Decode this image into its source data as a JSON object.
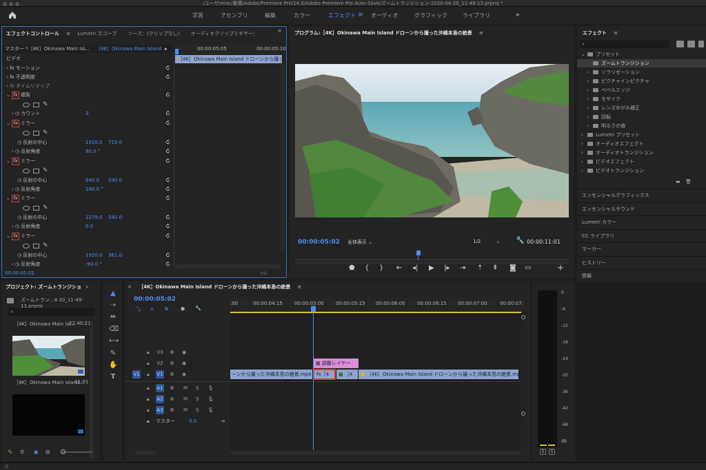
{
  "title": "/ユーザ/mac/書類/Adobe/Premiere Pro/14.0/Adobe Premiere Pro Auto-Save/ズームトランジション-2020-04-20_11-49-13.prproj *",
  "workspaces": [
    "学習",
    "アセンブリ",
    "編集",
    "カラー",
    "エフェクト",
    "オーディオ",
    "グラフィック",
    "ライブラリ"
  ],
  "effect_controls": {
    "tabs": [
      "エフェクトコントロール",
      "Lumetri スコープ",
      "ソース：(クリップなし)",
      "オーディオクリップミキサー："
    ],
    "master": "マスター *［4K］Okinawa Main Isl...",
    "clip": "［4K］Okinawa Main Island ...",
    "ruler": [
      "00:00:05:05",
      "00:00:05:10"
    ],
    "clipbar": "［4K］Okinawa Main Island ドローンから撮った沖縄本島の絶景",
    "section": "ビデオ",
    "motion": "モーション",
    "opacity": "不透明度",
    "timeremap": "タイムリマップ",
    "replicate": "複製",
    "count_label": "カウント",
    "count_value": "3",
    "mirror": "ミラー",
    "center_label": "反射の中心",
    "angle_label": "反射角度",
    "mirrors": [
      {
        "cx": "1920.0",
        "cy": "719.0",
        "angle": "90.0 °"
      },
      {
        "cx": "640.0",
        "cy": "540.0",
        "angle": "180.0 °"
      },
      {
        "cx": "1279.0",
        "cy": "540.0",
        "angle": "0.0"
      },
      {
        "cx": "1920.0",
        "cy": "361.0",
        "angle": "-90.0 °"
      }
    ],
    "timecode": "00:00:05:02"
  },
  "program": {
    "title": "プログラム:［4K］Okinawa Main Island ドローンから撮った沖縄本島の絶景",
    "timecode": "00:00:05:02",
    "zoom": "全体表示",
    "resolution": "1/2",
    "duration": "00:00:11:01"
  },
  "effects": {
    "title": "エフェクト",
    "tree": [
      {
        "label": "プリセット",
        "level": 0,
        "open": true
      },
      {
        "label": "ズームトランジション",
        "level": 1,
        "selected": true
      },
      {
        "label": "ソラリゼーション",
        "level": 1
      },
      {
        "label": "ピクチャインピクチャ",
        "level": 1
      },
      {
        "label": "ベベルエッジ",
        "level": 1
      },
      {
        "label": "モザイク",
        "level": 1
      },
      {
        "label": "レンズゆがみ補正",
        "level": 1
      },
      {
        "label": "回転",
        "level": 1
      },
      {
        "label": "明るさの値",
        "level": 1
      },
      {
        "label": "Lumetri プリセット",
        "level": 0
      },
      {
        "label": "オーディオエフェクト",
        "level": 0
      },
      {
        "label": "オーディオトランジション",
        "level": 0
      },
      {
        "label": "ビデオエフェクト",
        "level": 0
      },
      {
        "label": "ビデオトランジション",
        "level": 0
      }
    ],
    "panels": [
      "エッセンシャルグラフィックス",
      "エッセンシャルサウンド",
      "Lumetri カラー",
      "CC ライブラリ",
      "マーカー",
      "ヒストリー",
      "情報"
    ]
  },
  "project": {
    "title": "プロジェクト: ズームトランジショ",
    "file": "ズームトラン...4-20_11-49-13.prproj",
    "clip1_name": "［4K］Okinawa Main Isl...",
    "clip1_dur": "22:40:21",
    "clip2_name": "［4K］Okinawa Main Island...",
    "clip2_dur": "11:01"
  },
  "timeline": {
    "title": "［4K］Okinawa Main Island ドローンから撮った沖縄本島の絶景",
    "timecode": "00:00:05:02",
    "ruler": [
      ":00",
      "00:00:04:15",
      "00:00:05:00",
      "00:00:05:15",
      "00:00:06:00",
      "00:00:06:15",
      "00:00:07:00",
      "00:00:07:"
    ],
    "video_tracks": [
      "V3",
      "V2",
      "V1"
    ],
    "audio_tracks": [
      "A1",
      "A2",
      "A3"
    ],
    "source_v": "V1",
    "master_label": "マスター",
    "master_value": "0.0",
    "adjustment": "調整レイヤー",
    "clip_left": "ーンから撮った沖縄本島の絶景.mp4",
    "clip_fx": "fx［4",
    "clip_mid": "［4",
    "clip_right": "［4K］Okinawa Main Island ドローンから撮った沖縄本島の絶景.mp4",
    "mute": "M",
    "solo": "S"
  },
  "meter": {
    "scale": [
      "0",
      "-6",
      "-12",
      "-18",
      "-24",
      "-30",
      "-36",
      "-42",
      "-48",
      "dB"
    ],
    "solo": "S"
  },
  "colors": {
    "accent": "#4f8df0",
    "highlight": "#e53935",
    "clip_video": "#8fa4cf",
    "clip_adjust": "#d98fd8",
    "playhead": "#4f8df0"
  }
}
